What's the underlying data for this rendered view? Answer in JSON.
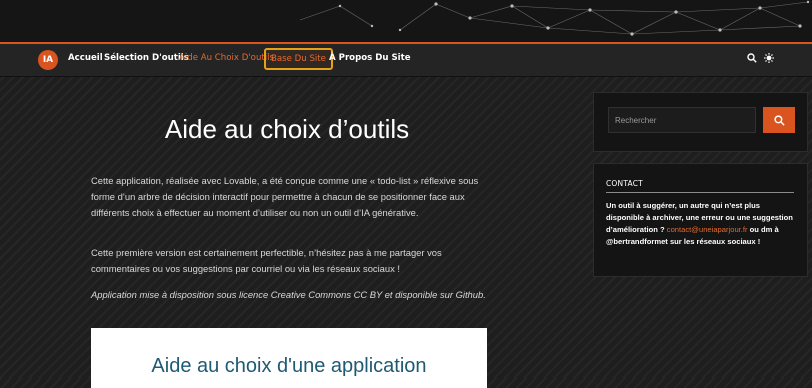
{
  "nav": {
    "logo_text": "IA",
    "items": [
      {
        "label": "Accueil"
      },
      {
        "label": "Sélection D'outils"
      },
      {
        "label": "Aide Au Choix D'outils"
      },
      {
        "label": "Base Du Site"
      },
      {
        "label": "À Propos Du Site"
      }
    ],
    "search_icon": "search-icon",
    "theme_icon": "sun-icon"
  },
  "main": {
    "title": "Aide au choix d’outils",
    "paragraph1": "Cette application, réalisée avec Lovable, a été conçue comme une « todo-list » réflexive sous forme d’un arbre de décision interactif pour permettre à chacun de se positionner face aux différents choix à effectuer au moment d’utiliser ou non un outil d’IA générative.",
    "paragraph2": "Cette première version est certainement perfectible, n’hésitez pas à me partager vos commentaires ou vos suggestions par courriel ou via les réseaux sociaux !",
    "paragraph3": "Application mise à disposition sous licence Creative Commons CC BY et disponible sur Github.",
    "card_title": "Aide au choix d'une application"
  },
  "sidebar": {
    "search_placeholder": "Rechercher",
    "contact_title": "CONTACT",
    "contact_text1": "Un outil à suggérer, un autre qui n’est plus disponible à archiver, une erreur ou une suggestion d’amélioration ?",
    "contact_email": "contact@uneiaparjour.fr",
    "contact_text2": " ou dm à @bertrandformet sur les réseaux sociaux !"
  },
  "colors": {
    "accent": "#d9541e",
    "highlight_border": "#e6a117",
    "card_title": "#1e5a73"
  }
}
